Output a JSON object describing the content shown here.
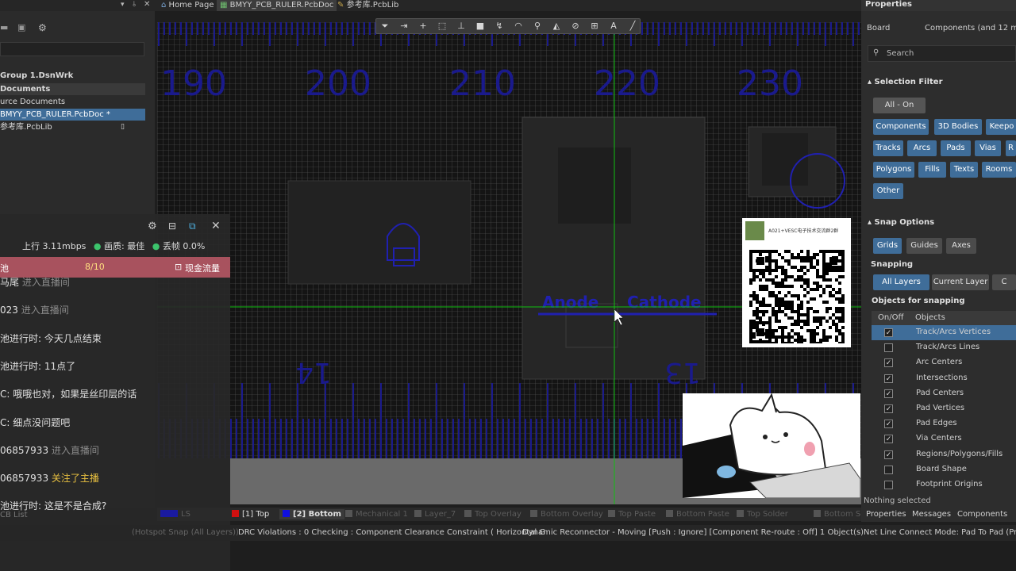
{
  "tabs": {
    "home": "Home Page",
    "pcb": "BMYY_PCB_RULER.PcbDoc",
    "lib": "参考库.PcbLib"
  },
  "projects": {
    "items": [
      {
        "label": "Group 1.DsnWrk"
      },
      {
        "label": "Documents"
      },
      {
        "label": "urce Documents"
      },
      {
        "label": "BMYY_PCB_RULER.PcbDoc *"
      },
      {
        "label": "参考库.PcbLib"
      }
    ]
  },
  "stream": {
    "upload": "上行",
    "upload_value": "3.11mbps",
    "quality_label": "画质: 最佳",
    "drop_label": "丢帧 0.0%",
    "pool_label": "池",
    "pool_count": "8/10",
    "pool_action": "现金流量"
  },
  "chat": [
    {
      "user": "马尾",
      "msg": " 进入直播间",
      "style": "dim"
    },
    {
      "user": "023",
      "msg": " 进入直播间",
      "style": "dim"
    },
    {
      "user": "池进行时:",
      "msg": " 今天几点结束",
      "style": "normal"
    },
    {
      "user": "池进行时:",
      "msg": " 11点了",
      "style": "normal"
    },
    {
      "user": "C:",
      "msg": " 哦哦也对，如果是丝印层的话",
      "style": "normal"
    },
    {
      "user": "C:",
      "msg": " 细点没问题吧",
      "style": "normal"
    },
    {
      "user": "06857933",
      "msg": " 进入直播间",
      "style": "dim"
    },
    {
      "user": "06857933",
      "msg": " 关注了主播",
      "style": "gold"
    },
    {
      "user": "池进行时:",
      "msg": " 这是不是合成?",
      "style": "normal"
    },
    {
      "user": "",
      "msg": "进入直播间",
      "style": "dim"
    }
  ],
  "canvas": {
    "ruler_numbers": [
      "190",
      "200",
      "210",
      "220",
      "230"
    ],
    "pin_labels": [
      "Anode",
      "Cathode"
    ],
    "mirror_labels": [
      "14",
      "13"
    ],
    "qr_caption": "A021+VESC电子技术交流群2群"
  },
  "properties": {
    "title": "Properties",
    "board_label": "Board",
    "components_label": "Components (and 12 mo",
    "search_placeholder": "Search",
    "selection_filter": "Selection Filter",
    "all_on": "All - On",
    "filters": [
      {
        "label": "Components",
        "on": true
      },
      {
        "label": "3D Bodies",
        "on": true
      },
      {
        "label": "Keepo",
        "on": true
      },
      {
        "label": "Tracks",
        "on": true
      },
      {
        "label": "Arcs",
        "on": true
      },
      {
        "label": "Pads",
        "on": true
      },
      {
        "label": "Vias",
        "on": true
      },
      {
        "label": "R",
        "on": true
      },
      {
        "label": "Polygons",
        "on": true
      },
      {
        "label": "Fills",
        "on": true
      },
      {
        "label": "Texts",
        "on": true
      },
      {
        "label": "Rooms",
        "on": true
      },
      {
        "label": "Other",
        "on": true
      }
    ],
    "snap_options": "Snap Options",
    "snap_buttons": [
      "Grids",
      "Guides",
      "Axes"
    ],
    "snapping": "Snapping",
    "snapping_modes": [
      "All Layers",
      "Current Layer",
      "C"
    ],
    "objects_for_snapping": "Objects for snapping",
    "col_onoff": "On/Off",
    "col_objects": "Objects",
    "snap_objects": [
      {
        "label": "Track/Arcs Vertices",
        "checked": true
      },
      {
        "label": "Track/Arcs Lines",
        "checked": false
      },
      {
        "label": "Arc Centers",
        "checked": true
      },
      {
        "label": "Intersections",
        "checked": true
      },
      {
        "label": "Pad Centers",
        "checked": true
      },
      {
        "label": "Pad Vertices",
        "checked": true
      },
      {
        "label": "Pad Edges",
        "checked": true
      },
      {
        "label": "Via Centers",
        "checked": true
      },
      {
        "label": "Regions/Polygons/Fills",
        "checked": true
      },
      {
        "label": "Board Shape",
        "checked": false
      },
      {
        "label": "Footprint Origins",
        "checked": false
      }
    ],
    "nothing_selected": "Nothing selected"
  },
  "bottom_tabs": [
    "Properties",
    "Messages",
    "Components"
  ],
  "layers": [
    {
      "label": "LS",
      "color": "#1a1aa0",
      "active": false
    },
    {
      "label": "[1] Top",
      "color": "#d01010",
      "active": true
    },
    {
      "label": "[2] Bottom",
      "color": "#1010e0",
      "active": true,
      "bold": true
    },
    {
      "label": "Mechanical 1",
      "color": "#555555",
      "active": false
    },
    {
      "label": "Layer_7",
      "color": "#555555",
      "active": false
    },
    {
      "label": "Top Overlay",
      "color": "#555555",
      "active": false
    },
    {
      "label": "Bottom Overlay",
      "color": "#555555",
      "active": false
    },
    {
      "label": "Top Paste",
      "color": "#555555",
      "active": false
    },
    {
      "label": "Bottom Paste",
      "color": "#555555",
      "active": false
    },
    {
      "label": "Top Solder",
      "color": "#555555",
      "active": false
    },
    {
      "label": "Bottom Solde",
      "color": "#555555",
      "active": false
    }
  ],
  "status": {
    "left": "CB List",
    "hotspot": "(Hotspot Snap (All Layers))",
    "drc": "DRC Violations : 0 Checking : Component Clearance Constraint ( Horizontal G",
    "reconnector": "Dynamic Reconnector - Moving [Push : Ignore] [Component Re-route : Off] 1 Object(s)Net Line Connect Mode: Pad To Pad (Press N to cha"
  },
  "colors": {
    "accent": "#3f6d99",
    "canvas": "#141414",
    "grid": "#5a5a5a",
    "copper_bottom": "#1a1a8c",
    "crosshair": "#10c010"
  }
}
